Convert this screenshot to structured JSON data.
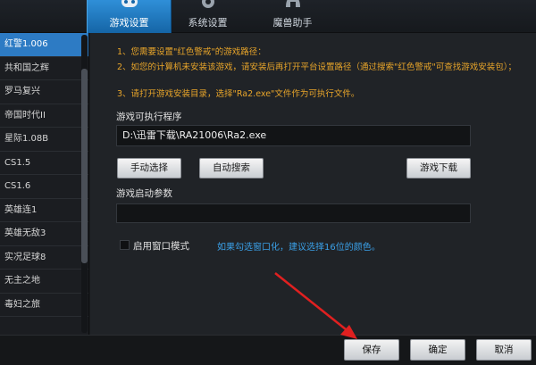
{
  "tabs": [
    {
      "label": "游戏设置",
      "icon": "gamepad-icon"
    },
    {
      "label": "系统设置",
      "icon": "gear-icon"
    },
    {
      "label": "魔兽助手",
      "icon": "helmet-icon"
    }
  ],
  "sidebar": {
    "items": [
      {
        "label": "红警1.006"
      },
      {
        "label": "共和国之辉"
      },
      {
        "label": "罗马复兴"
      },
      {
        "label": "帝国时代II"
      },
      {
        "label": "星际1.08B"
      },
      {
        "label": "CS1.5"
      },
      {
        "label": "CS1.6"
      },
      {
        "label": "英雄连1"
      },
      {
        "label": "英雄无敌3"
      },
      {
        "label": "实况足球8"
      },
      {
        "label": "无主之地"
      },
      {
        "label": "毒妇之旅"
      }
    ]
  },
  "main": {
    "note1": "1、您需要设置\"红色警戒\"的游戏路径：",
    "note2": "2、如您的计算机未安装该游戏，请安装后再打开平台设置路径（通过搜索\"红色警戒\"可查找游戏安装包）；",
    "note3": "3、请打开游戏安装目录，选择\"Ra2.exe\"文件作为可执行文件。",
    "exe_label": "游戏可执行程序",
    "exe_path": "D:\\迅雷下载\\RA21006\\Ra2.exe",
    "btn_manual": "手动选择",
    "btn_auto": "自动搜索",
    "btn_download": "游戏下载",
    "args_label": "游戏启动参数",
    "args_value": "",
    "window_mode_label": "启用窗口模式",
    "window_mode_hint": "如果勾选窗口化，建议选择16位的颜色。",
    "accent_color": "#2d7bc4",
    "note_color": "#e8a52a"
  },
  "footer": {
    "save": "保存",
    "ok": "确定",
    "cancel": "取消"
  }
}
